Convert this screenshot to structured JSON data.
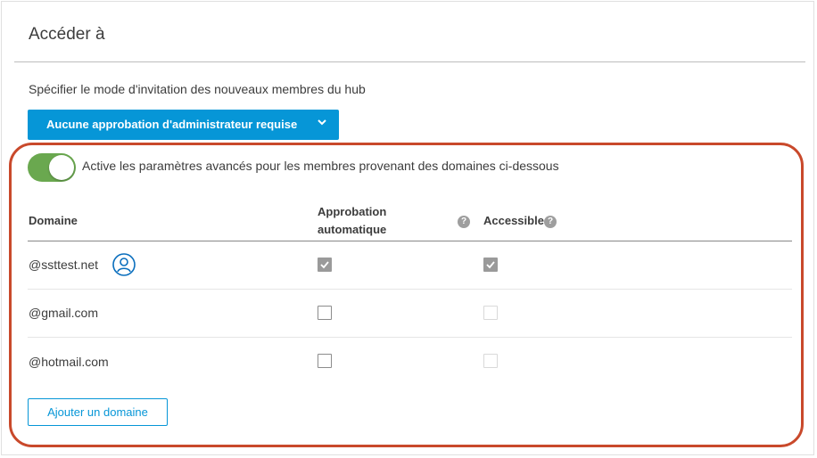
{
  "page": {
    "title": "Accéder à"
  },
  "invite": {
    "instruction": "Spécifier le mode d'invitation des nouveaux membres du hub",
    "dropdown_value": "Aucune approbation d'administrateur requise"
  },
  "advanced": {
    "toggle_on": true,
    "toggle_label": "Active les paramètres avancés pour les membres provenant des domaines ci-dessous"
  },
  "table": {
    "headers": {
      "domain": "Domaine",
      "auto_approval_line1": "Approbation",
      "auto_approval_line2": "automatique",
      "accessible": "Accessible"
    },
    "rows": [
      {
        "domain": "@ssttest.net",
        "auto_approval": true,
        "accessible": true,
        "has_user_icon": true
      },
      {
        "domain": "@gmail.com",
        "auto_approval": false,
        "accessible": false,
        "has_user_icon": false
      },
      {
        "domain": "@hotmail.com",
        "auto_approval": false,
        "accessible": false,
        "has_user_icon": false
      }
    ]
  },
  "actions": {
    "add_domain": "Ajouter un domaine"
  },
  "colors": {
    "primary": "#0696d7",
    "toggle_on": "#6aa84f",
    "highlight": "#c9492b"
  }
}
